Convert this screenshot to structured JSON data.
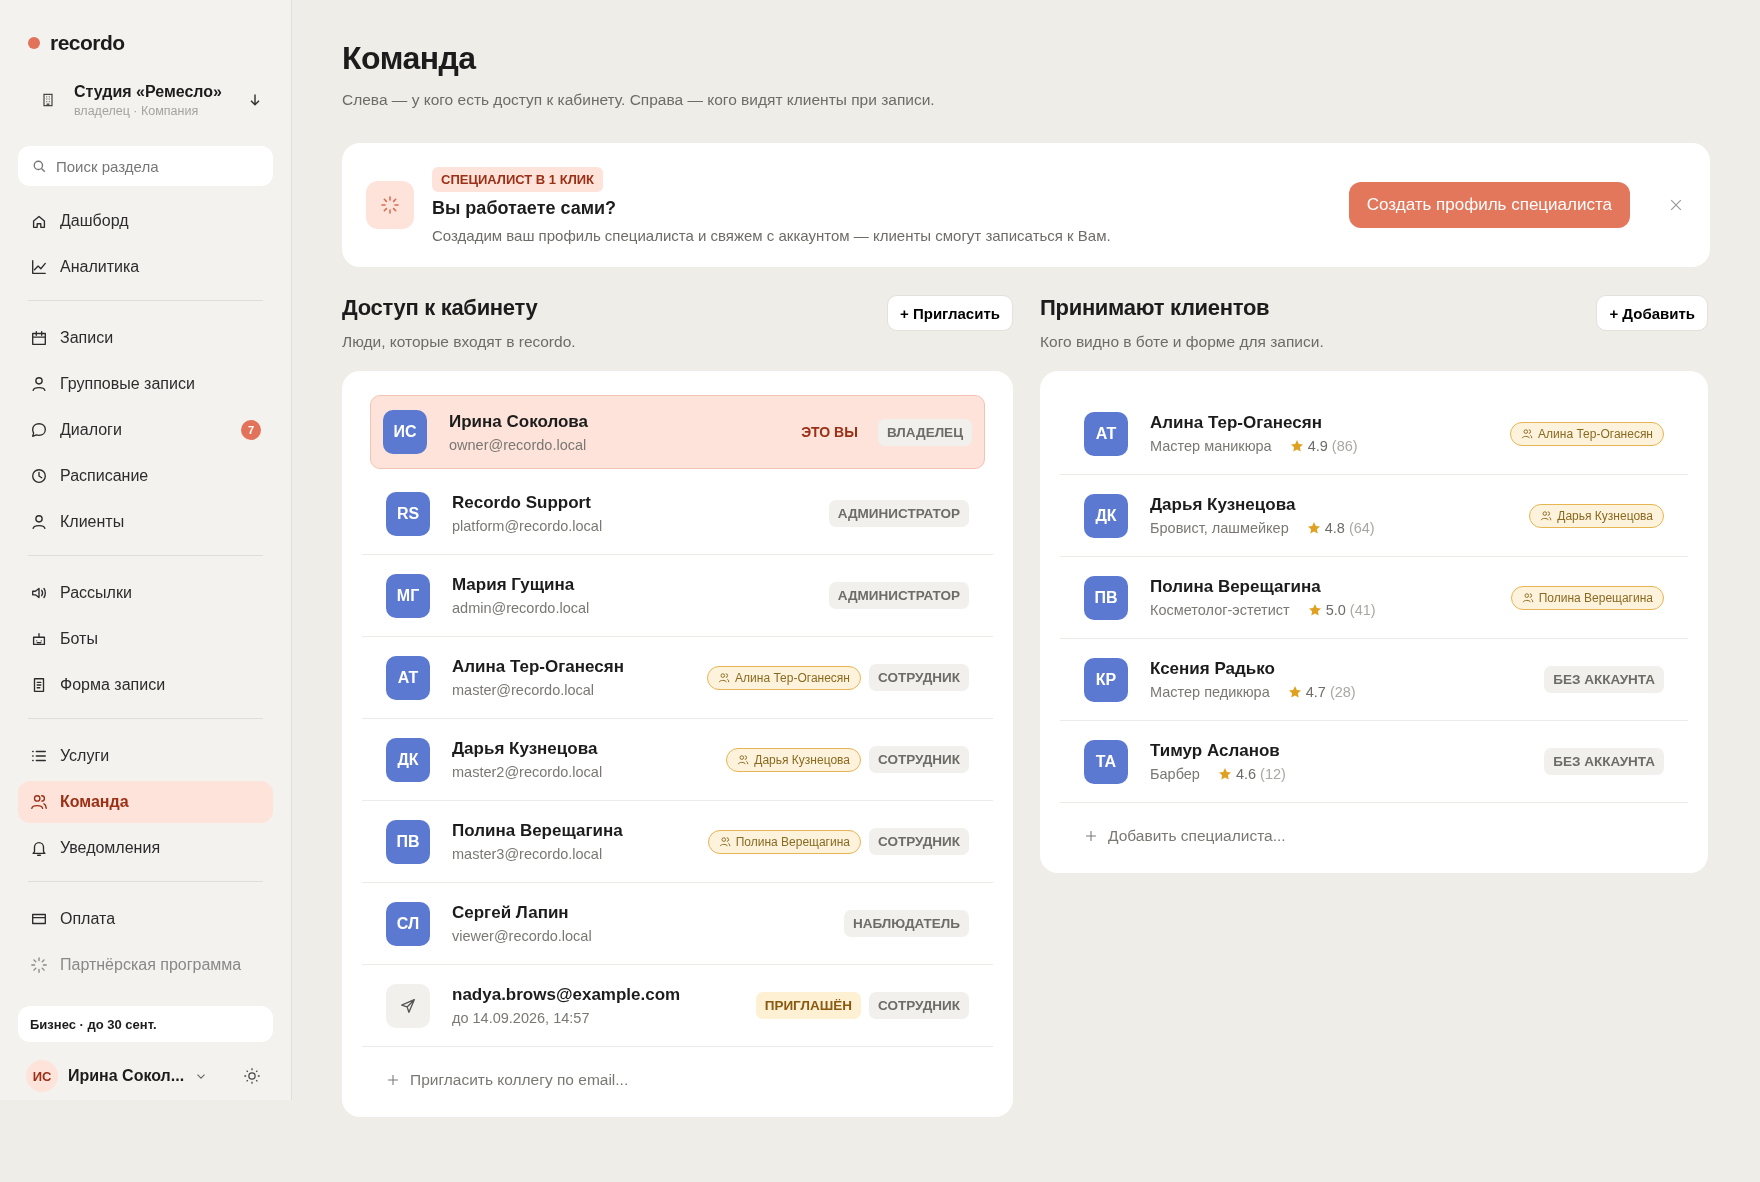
{
  "sidebar": {
    "brand": "recordo",
    "workspace": {
      "name": "Студия «Ремесло»",
      "meta": "владелец · Компания"
    },
    "search": {
      "placeholder": "Поиск раздела"
    },
    "groups": [
      {
        "items": [
          {
            "label": "Дашборд",
            "selected": false,
            "dimmed": false
          },
          {
            "label": "Аналитика",
            "selected": false,
            "dimmed": false
          }
        ]
      },
      {
        "items": [
          {
            "label": "Записи",
            "selected": false,
            "dimmed": false
          },
          {
            "label": "Групповые записи",
            "selected": false,
            "dimmed": false
          },
          {
            "label": "Диалоги",
            "selected": false,
            "dimmed": false,
            "badge": "7"
          },
          {
            "label": "Расписание",
            "selected": false,
            "dimmed": false
          },
          {
            "label": "Клиенты",
            "selected": false,
            "dimmed": false
          }
        ]
      },
      {
        "items": [
          {
            "label": "Рассылки",
            "selected": false,
            "dimmed": false
          },
          {
            "label": "Боты",
            "selected": false,
            "dimmed": false
          },
          {
            "label": "Форма записи",
            "selected": false,
            "dimmed": false
          }
        ]
      },
      {
        "items": [
          {
            "label": "Услуги",
            "selected": false,
            "dimmed": false
          },
          {
            "label": "Команда",
            "selected": true,
            "dimmed": false
          },
          {
            "label": "Уведомления",
            "selected": false,
            "dimmed": false
          }
        ]
      },
      {
        "items": [
          {
            "label": "Оплата",
            "selected": false,
            "dimmed": false
          },
          {
            "label": "Партнёрская программа",
            "selected": false,
            "dimmed": true
          }
        ]
      }
    ],
    "plan": "Бизнес · до 30 сент.",
    "user": {
      "initials": "ИС",
      "name": "Ирина Сокол..."
    }
  },
  "page": {
    "title": "Команда",
    "subtitle": "Слева — у кого есть доступ к кабинету. Справа — кого видят клиенты при записи."
  },
  "banner": {
    "tag": "СПЕЦИАЛИСТ В 1 КЛИК",
    "title": "Вы работаете сами?",
    "text": "Создадим ваш профиль специалиста и свяжем с аккаунтом — клиенты смогут записаться к Вам.",
    "button": "Создать профиль специалиста"
  },
  "access": {
    "title": "Доступ к кабинету",
    "subtitle": "Люди, которые входят в recordo.",
    "button": "+ Пригласить",
    "rows": [
      {
        "kind": "member",
        "initials": "ИС",
        "name": "Ирина Соколова",
        "email": "owner@recordo.local",
        "selected": true,
        "you": "ЭТО ВЫ",
        "role": "ВЛАДЕЛЕЦ"
      },
      {
        "kind": "member",
        "initials": "RS",
        "name": "Recordo Support",
        "email": "platform@recordo.local",
        "selected": false,
        "role": "АДМИНИСТРАТОР"
      },
      {
        "kind": "member",
        "initials": "МГ",
        "name": "Мария Гущина",
        "email": "admin@recordo.local",
        "selected": false,
        "role": "АДМИНИСТРАТОР"
      },
      {
        "kind": "member",
        "initials": "АТ",
        "name": "Алина Тер-Оганесян",
        "email": "master@recordo.local",
        "selected": false,
        "link": "Алина Тер-Оганесян",
        "role": "СОТРУДНИК"
      },
      {
        "kind": "member",
        "initials": "ДК",
        "name": "Дарья Кузнецова",
        "email": "master2@recordo.local",
        "selected": false,
        "link": "Дарья Кузнецова",
        "role": "СОТРУДНИК"
      },
      {
        "kind": "member",
        "initials": "ПВ",
        "name": "Полина Верещагина",
        "email": "master3@recordo.local",
        "selected": false,
        "link": "Полина Верещагина",
        "role": "СОТРУДНИК"
      },
      {
        "kind": "member",
        "initials": "СЛ",
        "name": "Сергей Лапин",
        "email": "viewer@recordo.local",
        "selected": false,
        "role": "НАБЛЮДАТЕЛЬ"
      },
      {
        "kind": "invite",
        "name": "nadya.brows@example.com",
        "email": "до 14.09.2026, 14:57",
        "selected": false,
        "status": "ПРИГЛАШЁН",
        "role": "СОТРУДНИК"
      }
    ],
    "add": "Пригласить коллегу по email..."
  },
  "specialists": {
    "title": "Принимают клиентов",
    "subtitle": "Кого видно в боте и форме для записи.",
    "button": "+ Добавить",
    "rows": [
      {
        "initials": "АТ",
        "name": "Алина Тер-Оганесян",
        "job": "Мастер маникюра",
        "rating": "4.9",
        "reviews": "(86)",
        "link": "Алина Тер-Оганесян"
      },
      {
        "initials": "ДК",
        "name": "Дарья Кузнецова",
        "job": "Бровист, лашмейкер",
        "rating": "4.8",
        "reviews": "(64)",
        "link": "Дарья Кузнецова"
      },
      {
        "initials": "ПВ",
        "name": "Полина Верещагина",
        "job": "Косметолог-эстетист",
        "rating": "5.0",
        "reviews": "(41)",
        "link": "Полина Верещагина"
      },
      {
        "initials": "КР",
        "name": "Ксения Радько",
        "job": "Мастер педикюра",
        "rating": "4.7",
        "reviews": "(28)",
        "status": "БЕЗ АККАУНТА"
      },
      {
        "initials": "ТА",
        "name": "Тимур Асланов",
        "job": "Барбер",
        "rating": "4.6",
        "reviews": "(12)",
        "status": "БЕЗ АККАУНТА"
      }
    ],
    "add": "Добавить специалиста..."
  }
}
